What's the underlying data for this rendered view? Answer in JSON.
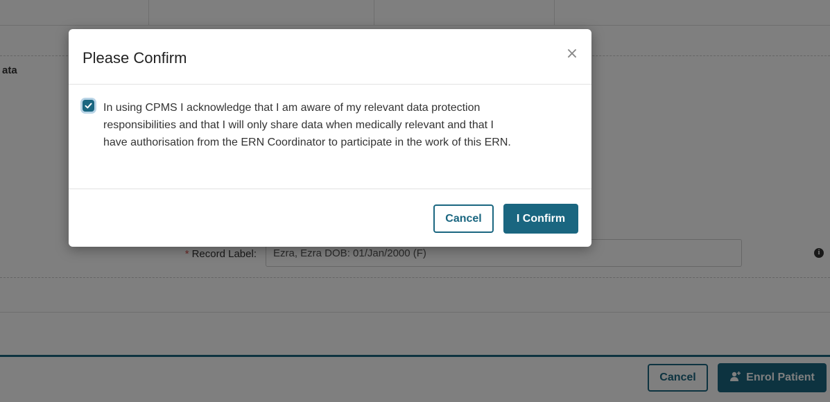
{
  "background": {
    "section_label": "ata",
    "record_label": {
      "required_mark": "*",
      "label": "Record Label:",
      "value": "Ezra, Ezra DOB: 01/Jan/2000 (F)",
      "info_icon": "info-icon"
    },
    "footer": {
      "cancel_label": "Cancel",
      "enrol_label": "Enrol Patient",
      "enrol_icon": "add-user-icon"
    }
  },
  "modal": {
    "title": "Please Confirm",
    "close_icon": "close-icon",
    "acknowledgement": {
      "checked": true,
      "text": "In using CPMS I acknowledge that I am aware of my relevant data protection responsibilities and that I will only share data when medically relevant and that I have authorisation from the ERN Coordinator to participate in the work of this ERN."
    },
    "cancel_label": "Cancel",
    "confirm_label": "I Confirm"
  },
  "colors": {
    "primary": "#1a6680",
    "backdrop": "rgba(0,0,0,0.5)",
    "required": "#d9534f"
  }
}
